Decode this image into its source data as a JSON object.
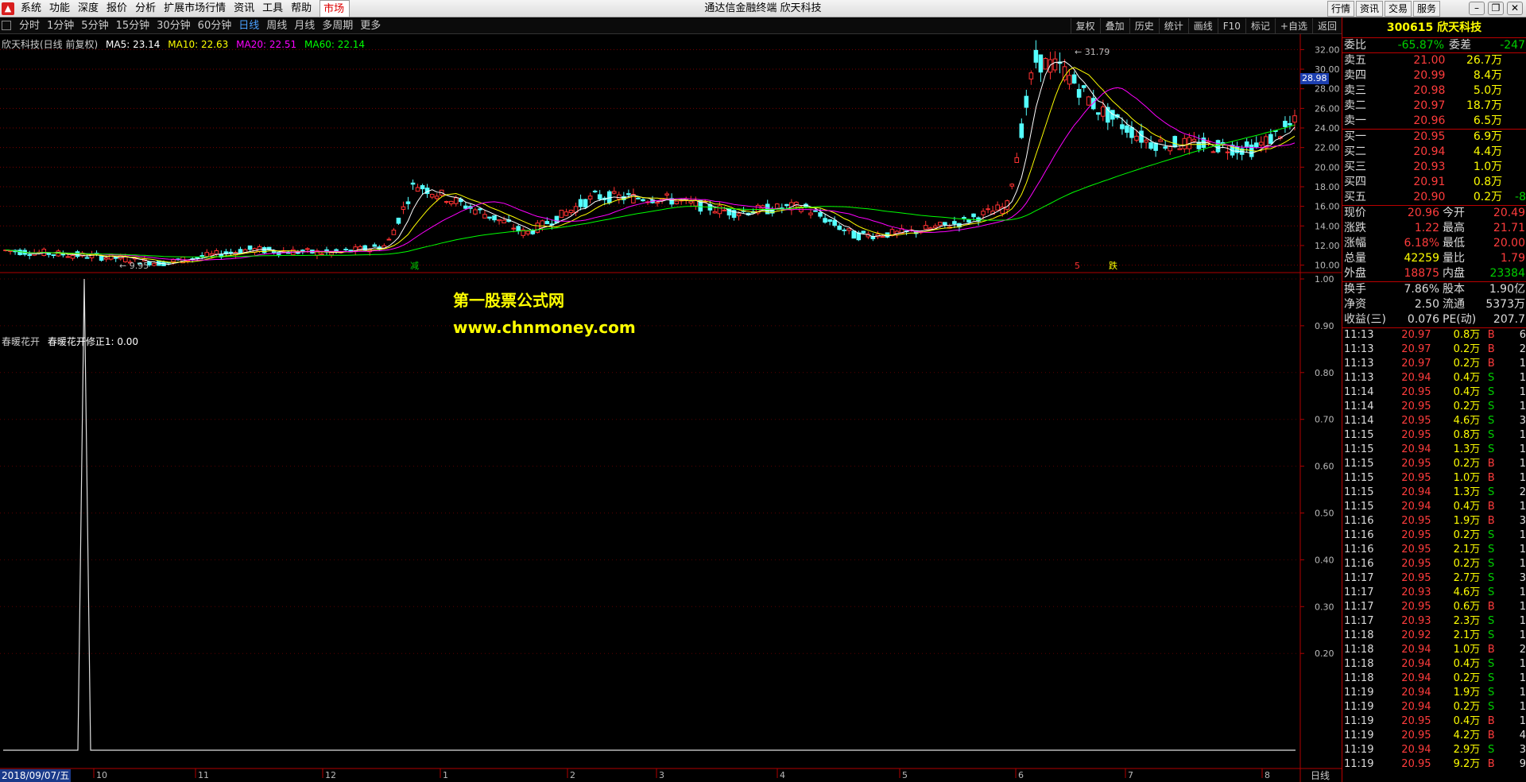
{
  "menu": [
    "系统",
    "功能",
    "深度",
    "报价",
    "分析",
    "扩展市场行情",
    "资讯",
    "工具",
    "帮助",
    "市场"
  ],
  "window_title": "通达信金融终端  欣天科技",
  "right_buttons": [
    "行情",
    "资讯",
    "交易",
    "服务"
  ],
  "periods": [
    "分时",
    "1分钟",
    "5分钟",
    "15分钟",
    "30分钟",
    "60分钟",
    "日线",
    "周线",
    "月线",
    "多周期",
    "更多"
  ],
  "selected_period": "日线",
  "tools": [
    "复权",
    "叠加",
    "历史",
    "统计",
    "画线",
    "F10",
    "标记",
    "+自选",
    "返回"
  ],
  "legend": {
    "name": "欣天科技(日线 前复权)",
    "ma5": "MA5: 23.14",
    "ma10": "MA10: 22.63",
    "ma20": "MA20: 22.51",
    "ma60": "MA60: 22.14"
  },
  "colors": {
    "ma5": "#ffffff",
    "ma10": "#ffff00",
    "ma20": "#ff00ff",
    "ma60": "#00ff00",
    "up": "#ff3232",
    "down": "#54ffff",
    "border": "#b00000"
  },
  "chart_data": [
    {
      "type": "candlestick",
      "title": "欣天科技(日线 前复权)",
      "ylim": [
        9.4,
        32.6
      ],
      "y_ticks": [
        10,
        12,
        14,
        16,
        18,
        20,
        22,
        24,
        26,
        28,
        30,
        32
      ],
      "x_months": [
        "10",
        "11",
        "12",
        "1",
        "2",
        "3",
        "4",
        "5",
        "6",
        "7",
        "8"
      ],
      "annotations": [
        "31.79",
        "9.95"
      ],
      "markers": [
        "减",
        "5",
        "跌"
      ],
      "current_price": "28.98",
      "high": 31.79,
      "low": 9.95
    },
    {
      "type": "line",
      "title": "春暖花开",
      "series": [
        {
          "name": "春暖花开修正1",
          "current": "0.00"
        }
      ],
      "ylim": [
        0,
        1.0
      ],
      "y_ticks": [
        "1.00",
        "0.90",
        "0.80",
        "0.70",
        "0.60",
        "0.50",
        "0.40",
        "0.30",
        "0.20"
      ]
    }
  ],
  "sub_legend": {
    "name": "春暖花开",
    "line": "春暖花开修正1: 0.00"
  },
  "watermark": {
    "line1": "第一股票公式网",
    "line2": "www.chnmoney.com"
  },
  "date_label": "2018/09/07/五",
  "period_label": "日线",
  "panel": {
    "code_name": "300615 欣天科技",
    "weibi": {
      "label1": "委比",
      "v1": "-65.87%",
      "label2": "委差",
      "v2": "-247"
    },
    "sells": [
      {
        "label": "卖五",
        "price": "21.00",
        "vol": "26.7万"
      },
      {
        "label": "卖四",
        "price": "20.99",
        "vol": "8.4万"
      },
      {
        "label": "卖三",
        "price": "20.98",
        "vol": "5.0万"
      },
      {
        "label": "卖二",
        "price": "20.97",
        "vol": "18.7万"
      },
      {
        "label": "卖一",
        "price": "20.96",
        "vol": "6.5万"
      }
    ],
    "buys": [
      {
        "label": "买一",
        "price": "20.95",
        "vol": "6.9万",
        "ch": ""
      },
      {
        "label": "买二",
        "price": "20.94",
        "vol": "4.4万",
        "ch": ""
      },
      {
        "label": "买三",
        "price": "20.93",
        "vol": "1.0万",
        "ch": ""
      },
      {
        "label": "买四",
        "price": "20.91",
        "vol": "0.8万",
        "ch": ""
      },
      {
        "label": "买五",
        "price": "20.90",
        "vol": "0.2万",
        "ch": "-8"
      }
    ],
    "quote": [
      {
        "l1": "现价",
        "v1": "20.96",
        "l2": "今开",
        "v2": "20.49"
      },
      {
        "l1": "涨跌",
        "v1": "1.22",
        "l2": "最高",
        "v2": "21.71"
      },
      {
        "l1": "涨幅",
        "v1": "6.18%",
        "l2": "最低",
        "v2": "20.00"
      },
      {
        "l1": "总量",
        "v1": "42259",
        "l2": "量比",
        "v2": "1.79"
      },
      {
        "l1": "外盘",
        "v1": "18875",
        "l2": "内盘",
        "v2": "23384"
      }
    ],
    "fundamentals": [
      {
        "l1": "换手",
        "v1": "7.86%",
        "l2": "股本",
        "v2": "1.90亿"
      },
      {
        "l1": "净资",
        "v1": "2.50",
        "l2": "流通",
        "v2": "5373万"
      },
      {
        "l1": "收益(三)",
        "v1": "0.076",
        "l2": "PE(动)",
        "v2": "207.7"
      }
    ],
    "ticks": [
      [
        "11:13",
        "20.97",
        "0.8万",
        "B",
        "6"
      ],
      [
        "11:13",
        "20.97",
        "0.2万",
        "B",
        "2"
      ],
      [
        "11:13",
        "20.97",
        "0.2万",
        "B",
        "1"
      ],
      [
        "11:13",
        "20.94",
        "0.4万",
        "S",
        "1"
      ],
      [
        "11:14",
        "20.95",
        "0.4万",
        "S",
        "1"
      ],
      [
        "11:14",
        "20.95",
        "0.2万",
        "S",
        "1"
      ],
      [
        "11:14",
        "20.95",
        "4.6万",
        "S",
        "3"
      ],
      [
        "11:15",
        "20.95",
        "0.8万",
        "S",
        "1"
      ],
      [
        "11:15",
        "20.94",
        "1.3万",
        "S",
        "1"
      ],
      [
        "11:15",
        "20.95",
        "0.2万",
        "B",
        "1"
      ],
      [
        "11:15",
        "20.95",
        "1.0万",
        "B",
        "1"
      ],
      [
        "11:15",
        "20.94",
        "1.3万",
        "S",
        "2"
      ],
      [
        "11:15",
        "20.94",
        "0.4万",
        "B",
        "1"
      ],
      [
        "11:16",
        "20.95",
        "1.9万",
        "B",
        "3"
      ],
      [
        "11:16",
        "20.95",
        "0.2万",
        "S",
        "1"
      ],
      [
        "11:16",
        "20.95",
        "2.1万",
        "S",
        "1"
      ],
      [
        "11:16",
        "20.95",
        "0.2万",
        "S",
        "1"
      ],
      [
        "11:17",
        "20.95",
        "2.7万",
        "S",
        "3"
      ],
      [
        "11:17",
        "20.93",
        "4.6万",
        "S",
        "1"
      ],
      [
        "11:17",
        "20.95",
        "0.6万",
        "B",
        "1"
      ],
      [
        "11:17",
        "20.93",
        "2.3万",
        "S",
        "1"
      ],
      [
        "11:18",
        "20.92",
        "2.1万",
        "S",
        "1"
      ],
      [
        "11:18",
        "20.94",
        "1.0万",
        "B",
        "2"
      ],
      [
        "11:18",
        "20.94",
        "0.4万",
        "S",
        "1"
      ],
      [
        "11:18",
        "20.94",
        "0.2万",
        "S",
        "1"
      ],
      [
        "11:19",
        "20.94",
        "1.9万",
        "S",
        "1"
      ],
      [
        "11:19",
        "20.94",
        "0.2万",
        "S",
        "1"
      ],
      [
        "11:19",
        "20.95",
        "0.4万",
        "B",
        "1"
      ],
      [
        "11:19",
        "20.95",
        "4.2万",
        "B",
        "4"
      ],
      [
        "11:19",
        "20.94",
        "2.9万",
        "S",
        "3"
      ],
      [
        "11:19",
        "20.95",
        "9.2万",
        "B",
        "9"
      ]
    ]
  }
}
